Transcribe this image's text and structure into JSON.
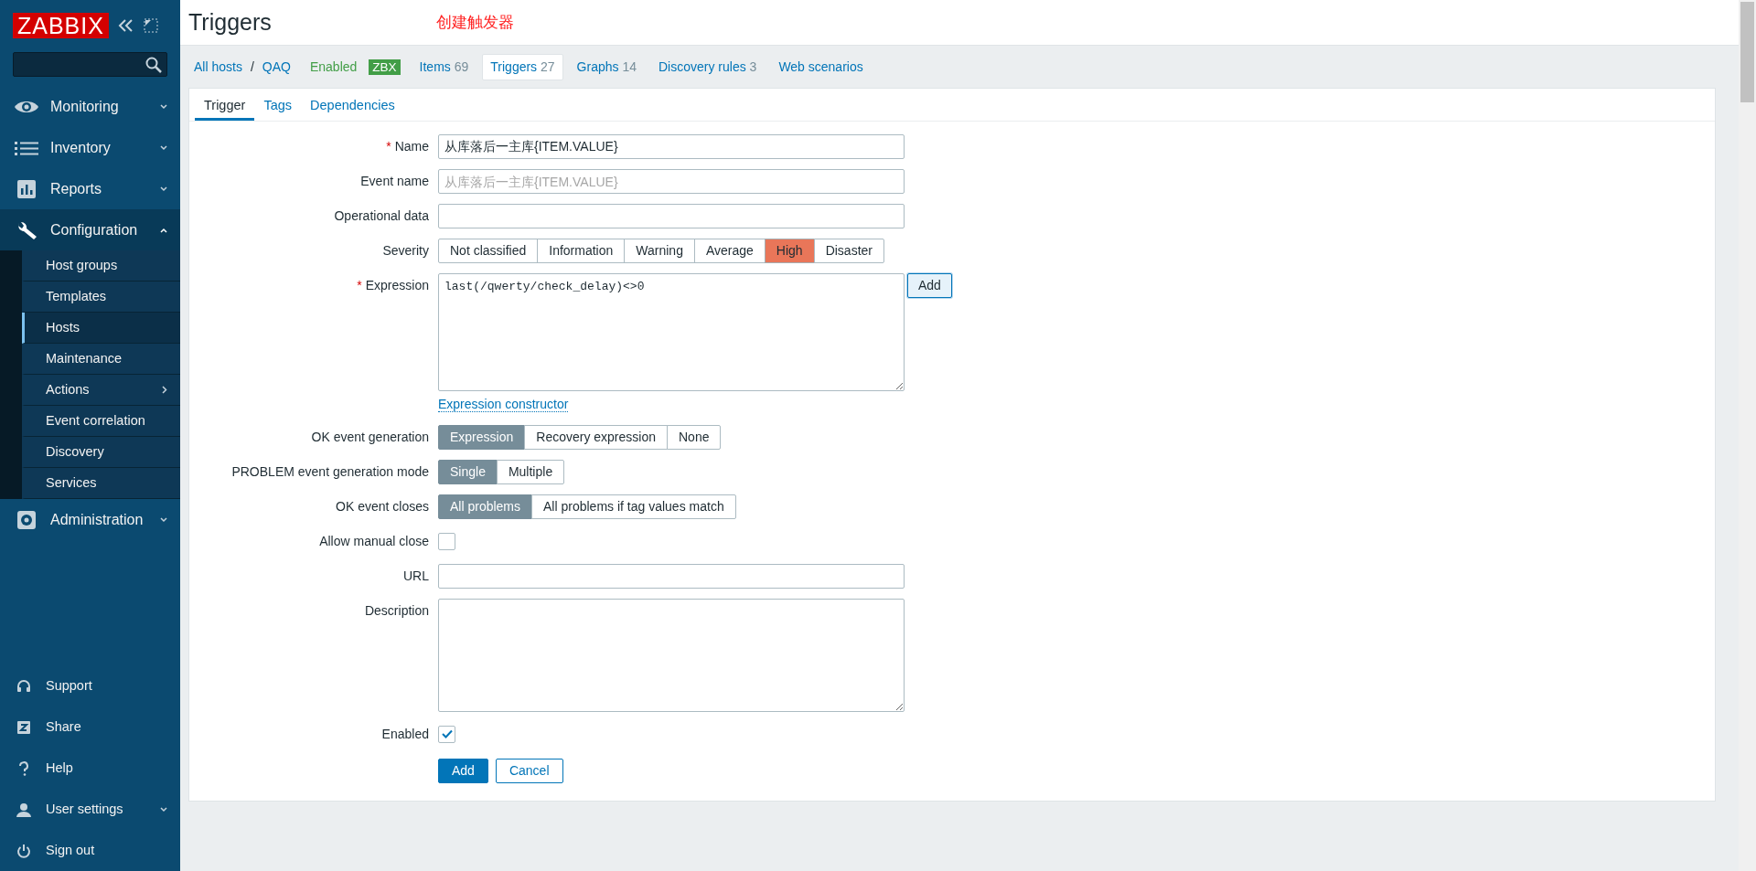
{
  "sidebar": {
    "logo": "ZABBIX",
    "menu": [
      {
        "label": "Monitoring",
        "expanded": false
      },
      {
        "label": "Inventory",
        "expanded": false
      },
      {
        "label": "Reports",
        "expanded": false
      },
      {
        "label": "Configuration",
        "expanded": true,
        "children": [
          {
            "label": "Host groups",
            "selected": false,
            "kind": "link"
          },
          {
            "label": "Templates",
            "selected": false,
            "kind": "link"
          },
          {
            "label": "Hosts",
            "selected": true,
            "kind": "link"
          },
          {
            "label": "Maintenance",
            "selected": false,
            "kind": "link"
          },
          {
            "label": "Actions",
            "selected": false,
            "kind": "submenu"
          },
          {
            "label": "Event correlation",
            "selected": false,
            "kind": "link"
          },
          {
            "label": "Discovery",
            "selected": false,
            "kind": "link"
          },
          {
            "label": "Services",
            "selected": false,
            "kind": "link"
          }
        ]
      },
      {
        "label": "Administration",
        "expanded": false
      }
    ],
    "bottom": [
      {
        "label": "Support",
        "kind": "link"
      },
      {
        "label": "Share",
        "kind": "link"
      },
      {
        "label": "Help",
        "kind": "link"
      },
      {
        "label": "User settings",
        "kind": "menu"
      },
      {
        "label": "Sign out",
        "kind": "link"
      }
    ]
  },
  "header": {
    "title": "Triggers",
    "annotation": "创建触发器"
  },
  "breadcrumbs": {
    "items": [
      "All hosts",
      "QAQ"
    ],
    "separator": "/"
  },
  "host_status": {
    "label": "Enabled",
    "badge": "ZBX"
  },
  "host_tabs": [
    {
      "label": "Items",
      "count": "69",
      "selected": false
    },
    {
      "label": "Triggers",
      "count": "27",
      "selected": true
    },
    {
      "label": "Graphs",
      "count": "14",
      "selected": false
    },
    {
      "label": "Discovery rules",
      "count": "3",
      "selected": false
    },
    {
      "label": "Web scenarios",
      "selected": false
    }
  ],
  "form_tabs": [
    {
      "label": "Trigger",
      "selected": true
    },
    {
      "label": "Tags",
      "selected": false
    },
    {
      "label": "Dependencies",
      "selected": false
    }
  ],
  "fields": [
    {
      "kind": "text",
      "label": "Name",
      "required_mark": "*",
      "value": "从库落后一主库{ITEM.VALUE}"
    },
    {
      "kind": "text",
      "label": "Event name",
      "placeholder": "从库落后一主库{ITEM.VALUE}"
    },
    {
      "kind": "text",
      "label": "Operational data"
    },
    {
      "kind": "severity",
      "label": "Severity",
      "options": [
        {
          "label": "Not classified",
          "selected": false
        },
        {
          "label": "Information",
          "selected": false
        },
        {
          "label": "Warning",
          "selected": false
        },
        {
          "label": "Average",
          "selected": false
        },
        {
          "label": "High",
          "selected": true
        },
        {
          "label": "Disaster",
          "selected": false
        }
      ]
    },
    {
      "kind": "expression",
      "label": "Expression",
      "required_mark": "*",
      "value": "last(/qwerty/check_delay)<>0",
      "button": "Add",
      "link": "Expression constructor"
    },
    {
      "kind": "radio",
      "label": "OK event generation",
      "options": [
        {
          "label": "Expression",
          "selected": true
        },
        {
          "label": "Recovery expression",
          "selected": false
        },
        {
          "label": "None",
          "selected": false
        }
      ]
    },
    {
      "kind": "radio",
      "label": "PROBLEM event generation mode",
      "options": [
        {
          "label": "Single",
          "selected": true
        },
        {
          "label": "Multiple",
          "selected": false
        }
      ]
    },
    {
      "kind": "radio",
      "label": "OK event closes",
      "options": [
        {
          "label": "All problems",
          "selected": true
        },
        {
          "label": "All problems if tag values match",
          "selected": false
        }
      ]
    },
    {
      "kind": "checkbox",
      "label": "Allow manual close",
      "checked": false
    },
    {
      "kind": "text",
      "label": "URL"
    },
    {
      "kind": "textarea",
      "label": "Description"
    },
    {
      "kind": "checkbox",
      "label": "Enabled",
      "checked": true
    }
  ],
  "buttons": [
    {
      "label": "Add",
      "kind": "primary"
    },
    {
      "label": "Cancel",
      "kind": "secondary"
    }
  ]
}
